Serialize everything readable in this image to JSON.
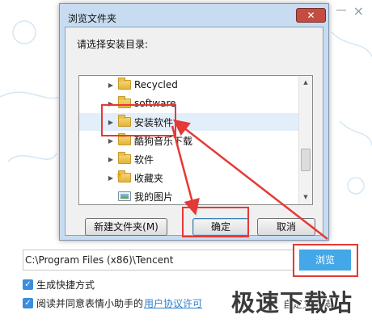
{
  "installer": {
    "close_glyph": "×",
    "install_path_value": "C:\\Program Files (x86)\\Tencent",
    "browse_label": "浏览",
    "checkbox_shortcut_label": "生成快捷方式",
    "checkbox_agreement_label": "阅读并同意表情小助手的",
    "agreement_link": "用户协议许可",
    "custom_label": "自定义安装",
    "check_glyph": "✓"
  },
  "dialog": {
    "title": "浏览文件夹",
    "close_glyph": "✕",
    "prompt": "请选择安装目录:",
    "tree_items": [
      {
        "label": "Recycled",
        "icon": "folder-icon"
      },
      {
        "label": "software",
        "icon": "folder-icon"
      },
      {
        "label": "安装软件",
        "icon": "folder-icon",
        "selected": true
      },
      {
        "label": "酷狗音乐下载",
        "icon": "folder-icon"
      },
      {
        "label": "软件",
        "icon": "folder-icon"
      },
      {
        "label": "收藏夹",
        "icon": "favorites-folder-icon"
      },
      {
        "label": "我的图片",
        "icon": "pictures-folder-icon"
      }
    ],
    "new_folder_label": "新建文件夹(M)",
    "ok_label": "确定",
    "cancel_label": "取消"
  },
  "watermark": "极速下载站",
  "colors": {
    "accent_blue": "#43a7e8",
    "highlight_red": "#e53935",
    "dialog_frame": "#c7dcf0"
  }
}
